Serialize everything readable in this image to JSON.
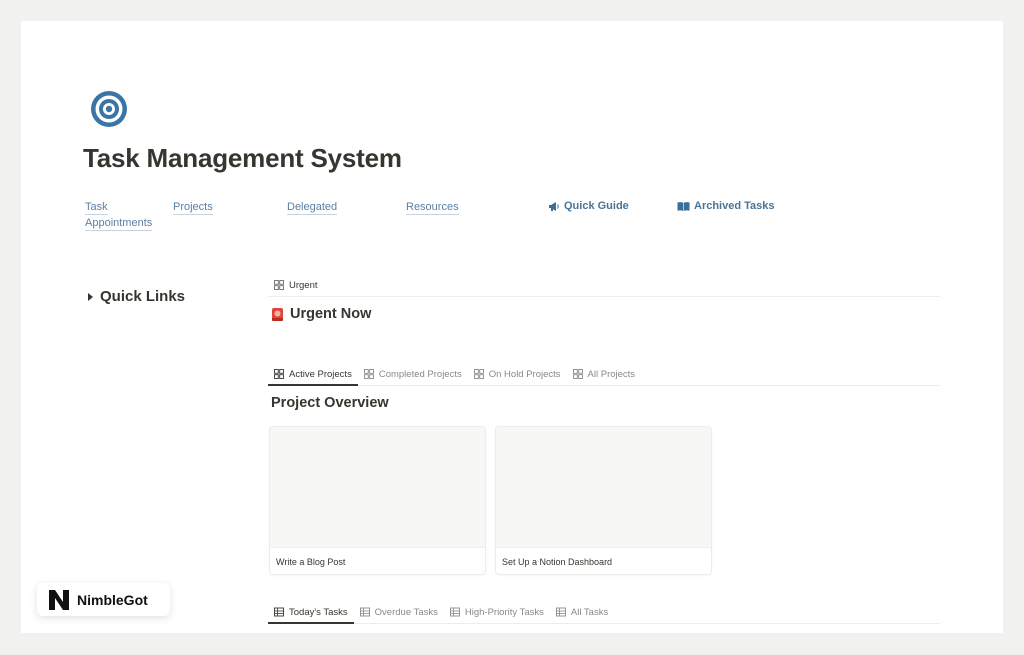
{
  "page": {
    "title": "Task Management System",
    "icon": "target-icon",
    "accent_color": "#3a75a5"
  },
  "nav_links": {
    "task": "Task",
    "appointments": "Appointments",
    "projects": "Projects",
    "delegated": "Delegated",
    "resources": "Resources",
    "quick_guide": "Quick Guide",
    "archived_tasks": "Archived Tasks"
  },
  "quick_links": {
    "label": "Quick Links"
  },
  "urgent": {
    "tabs": [
      {
        "label": "Urgent",
        "active": false
      }
    ],
    "heading": "Urgent Now",
    "heading_icon": "siren-icon"
  },
  "projects": {
    "tabs": [
      {
        "label": "Active Projects",
        "active": true
      },
      {
        "label": "Completed Projects",
        "active": false
      },
      {
        "label": "On Hold Projects",
        "active": false
      },
      {
        "label": "All Projects",
        "active": false
      }
    ],
    "heading": "Project Overview",
    "cards": [
      {
        "title": "Write a Blog Post"
      },
      {
        "title": "Set Up a Notion Dashboard"
      }
    ]
  },
  "tasks": {
    "tabs": [
      {
        "label": "Today's Tasks",
        "active": true
      },
      {
        "label": "Overdue Tasks",
        "active": false
      },
      {
        "label": "High-Priority Tasks",
        "active": false
      },
      {
        "label": "All Tasks",
        "active": false
      }
    ]
  },
  "watermark": {
    "brand": "NimbleGot"
  }
}
